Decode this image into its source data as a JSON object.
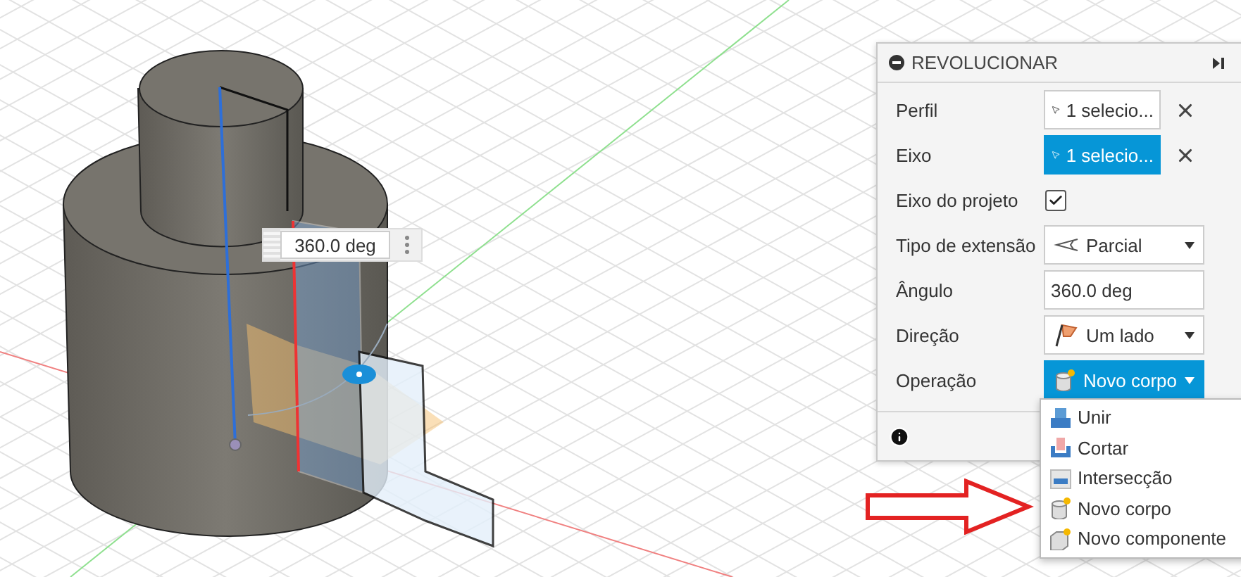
{
  "viewport": {
    "dimension_input": {
      "value": "360.0 deg"
    }
  },
  "panel": {
    "title": "REVOLUCIONAR",
    "rows": [
      {
        "kind": "selection",
        "label": "Perfil",
        "value": "1 selecio...",
        "selected": false
      },
      {
        "kind": "selection",
        "label": "Eixo",
        "value": "1 selecio...",
        "selected": true
      },
      {
        "kind": "checkbox",
        "label": "Eixo do projeto",
        "checked": true
      },
      {
        "kind": "extent",
        "label": "Tipo de extensão",
        "value": "Parcial",
        "expanded": false
      },
      {
        "kind": "input",
        "label": "Ângulo",
        "value": "360.0 deg"
      },
      {
        "kind": "direction",
        "label": "Direção",
        "value": "Um lado",
        "expanded": false
      },
      {
        "kind": "operation",
        "label": "Operação",
        "value": "Novo corpo",
        "expanded": true
      }
    ]
  },
  "operation_menu": {
    "items": [
      {
        "label": "Unir",
        "kind": "join"
      },
      {
        "label": "Cortar",
        "kind": "cut"
      },
      {
        "label": "Intersecção",
        "kind": "intersect"
      },
      {
        "label": "Novo corpo",
        "kind": "new-body"
      },
      {
        "label": "Novo componente",
        "kind": "new-component"
      }
    ]
  }
}
